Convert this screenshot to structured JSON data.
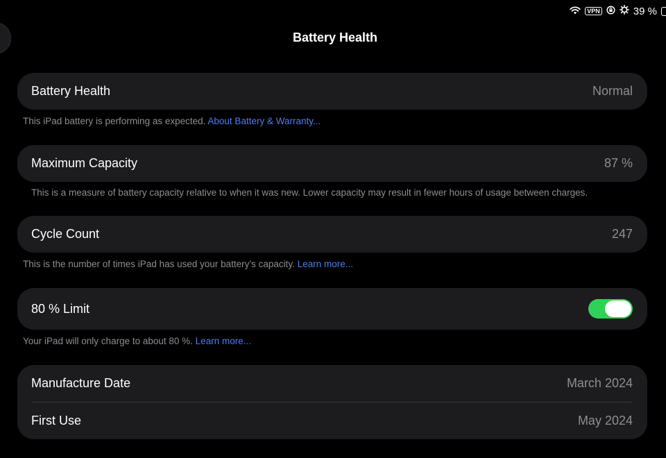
{
  "status_bar": {
    "icons": [
      "wifi-icon",
      "vpn-icon",
      "screen-lock-icon",
      "focus-icon",
      "battery-icon"
    ],
    "vpn_label": "VPN",
    "battery_percent": "39 %"
  },
  "page": {
    "title": "Battery Health"
  },
  "battery_health": {
    "label": "Battery Health",
    "value": "Normal",
    "footnote": "This iPad battery is performing as expected.",
    "footnote_link": "About Battery & Warranty..."
  },
  "maximum_capacity": {
    "label": "Maximum Capacity",
    "value": "87 %",
    "footnote": "This is a measure of battery capacity relative to when it was new. Lower capacity may result in fewer hours of usage between charges."
  },
  "cycle_count": {
    "label": "Cycle Count",
    "value": "247",
    "footnote": "This is the number of times iPad has used your battery’s capacity.",
    "footnote_link": "Learn more..."
  },
  "limit": {
    "label": "80 % Limit",
    "enabled": true,
    "toggle_color": "#30d158",
    "footnote": "Your iPad will only charge to about 80 %.",
    "footnote_link": "Learn more..."
  },
  "dates": {
    "manufacture_label": "Manufacture Date",
    "manufacture_value": "March 2024",
    "first_use_label": "First Use",
    "first_use_value": "May 2024"
  },
  "colors": {
    "background": "#000000",
    "card": "#1c1c1e",
    "secondary_text": "#8e8e93",
    "link": "#4f7cf0"
  }
}
